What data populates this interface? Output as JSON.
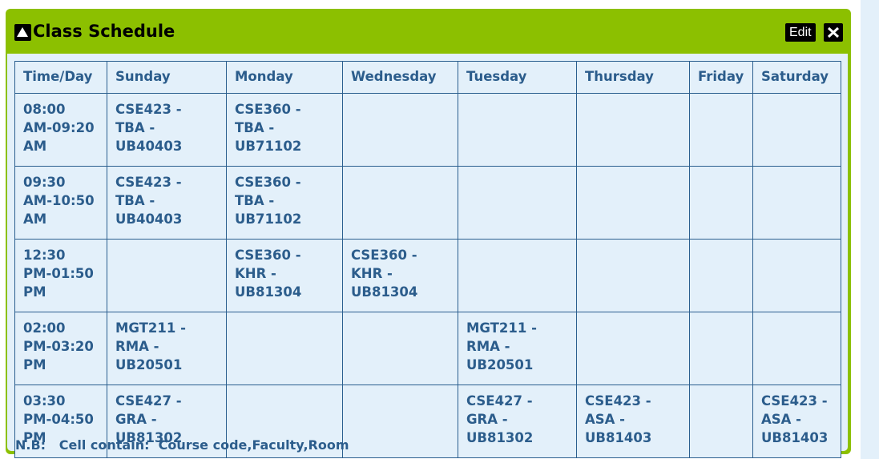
{
  "panel": {
    "title": "Class Schedule",
    "edit_label": "Edit",
    "collapse_icon": "triangle-up-icon",
    "close_icon": "close-x-icon"
  },
  "colors": {
    "header_green": "#8cc000",
    "body_bg": "#e3f0fa",
    "text_blue": "#2c5d8c",
    "grid_line": "#2b5f8f"
  },
  "schedule": {
    "headers": [
      "Time/Day",
      "Sunday",
      "Monday",
      "Wednesday",
      "Tuesday",
      "Thursday",
      "Friday",
      "Saturday"
    ],
    "rows": [
      {
        "time": [
          "08:00",
          "AM-09:20",
          "AM"
        ],
        "cells": [
          [
            "CSE423 -",
            "TBA -",
            "UB40403"
          ],
          [
            "CSE360 -",
            "TBA -",
            "UB71102"
          ],
          [],
          [],
          [],
          [],
          []
        ]
      },
      {
        "time": [
          "09:30",
          "AM-10:50",
          "AM"
        ],
        "cells": [
          [
            "CSE423 -",
            "TBA -",
            "UB40403"
          ],
          [
            "CSE360 -",
            "TBA -",
            "UB71102"
          ],
          [],
          [],
          [],
          [],
          []
        ]
      },
      {
        "time": [
          "12:30",
          "PM-01:50",
          "PM"
        ],
        "cells": [
          [],
          [
            "CSE360 -",
            "KHR -",
            "UB81304"
          ],
          [
            "CSE360 -",
            "KHR -",
            "UB81304"
          ],
          [],
          [],
          [],
          []
        ]
      },
      {
        "time": [
          "02:00",
          "PM-03:20",
          "PM"
        ],
        "cells": [
          [
            "MGT211 -",
            "RMA -",
            "UB20501"
          ],
          [],
          [],
          [
            "MGT211 -",
            "RMA -",
            "UB20501"
          ],
          [],
          [],
          []
        ]
      },
      {
        "time": [
          "03:30",
          "PM-04:50",
          "PM"
        ],
        "cells": [
          [
            "CSE427 -",
            "GRA -",
            "UB81302"
          ],
          [],
          [],
          [
            "CSE427 -",
            "GRA -",
            "UB81302"
          ],
          [
            "CSE423 -",
            "ASA -",
            "UB81403"
          ],
          [],
          [
            "CSE423 -",
            "ASA -",
            "UB81403"
          ]
        ]
      }
    ]
  },
  "note": {
    "label": "N.B:",
    "text": "Cell contain:  Course code,Faculty,Room"
  }
}
